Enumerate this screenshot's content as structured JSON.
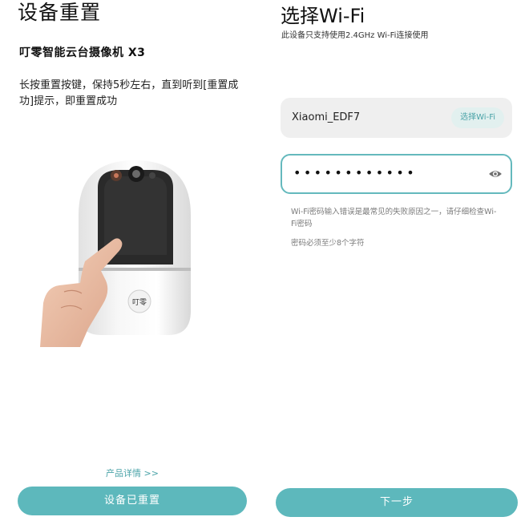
{
  "reset_screen": {
    "title": "设备重置",
    "device_name": "叮零智能云台摄像机 X3",
    "instruction": "长按重置按键，保持5秒左右，直到听到[重置成功]提示，即重置成功",
    "camera_logo": "叮零",
    "product_link": "产品详情 >>",
    "confirm_button": "设备已重置"
  },
  "wifi_screen": {
    "title": "选择Wi-Fi",
    "subtitle": "此设备只支持使用2.4GHz Wi-Fi连接使用",
    "ssid": "Xiaomi_EDF7",
    "choose_wifi_button": "选择Wi-Fi",
    "password_masked": "••••••••••••",
    "hint_1": "Wi-Fi密码输入错误是最常见的失败原因之一，请仔细检查Wi-Fi密码",
    "hint_2": "密码必须至少8个字符",
    "next_button": "下一步"
  },
  "colors": {
    "accent": "#5db8bc",
    "accent_text": "#4aa3a8",
    "field_bg": "#efefef"
  },
  "icons": {
    "password_visibility": "eye-icon"
  }
}
